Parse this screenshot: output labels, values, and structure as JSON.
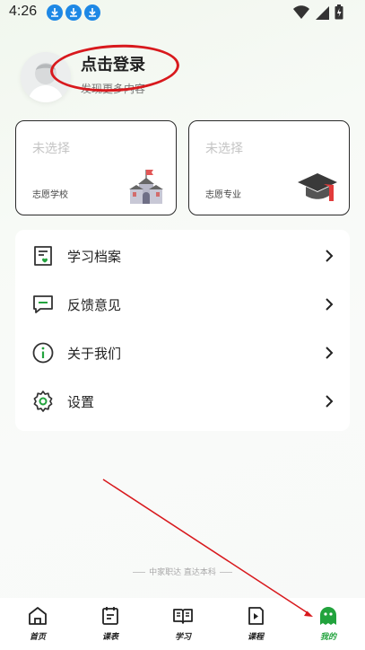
{
  "status_bar": {
    "time": "4:26",
    "download_icons": [
      "download-icon",
      "download-icon",
      "download-icon"
    ],
    "right_icons": [
      "wifi-icon",
      "signal-icon",
      "battery-charging-icon"
    ]
  },
  "profile": {
    "title": "点击登录",
    "subtitle": "发现更多内容"
  },
  "cards": [
    {
      "value": "未选择",
      "label": "志愿学校",
      "icon": "school-building-icon"
    },
    {
      "value": "未选择",
      "label": "志愿专业",
      "icon": "graduation-cap-icon"
    }
  ],
  "menu": [
    {
      "label": "学习档案",
      "icon": "study-record-icon"
    },
    {
      "label": "反馈意见",
      "icon": "feedback-icon"
    },
    {
      "label": "关于我们",
      "icon": "info-icon"
    },
    {
      "label": "设置",
      "icon": "settings-gear-icon"
    }
  ],
  "footer": {
    "slogan": "中家职达 直达本科"
  },
  "bottom_nav": {
    "active_index": 4,
    "items": [
      {
        "label": "首页",
        "icon": "home-icon"
      },
      {
        "label": "课表",
        "icon": "schedule-icon"
      },
      {
        "label": "学习",
        "icon": "book-icon"
      },
      {
        "label": "课程",
        "icon": "course-play-icon"
      },
      {
        "label": "我的",
        "icon": "profile-icon"
      }
    ]
  },
  "colors": {
    "accent": "#22a33d",
    "annotation": "#d8191d",
    "download_blue": "#1e88e5"
  }
}
